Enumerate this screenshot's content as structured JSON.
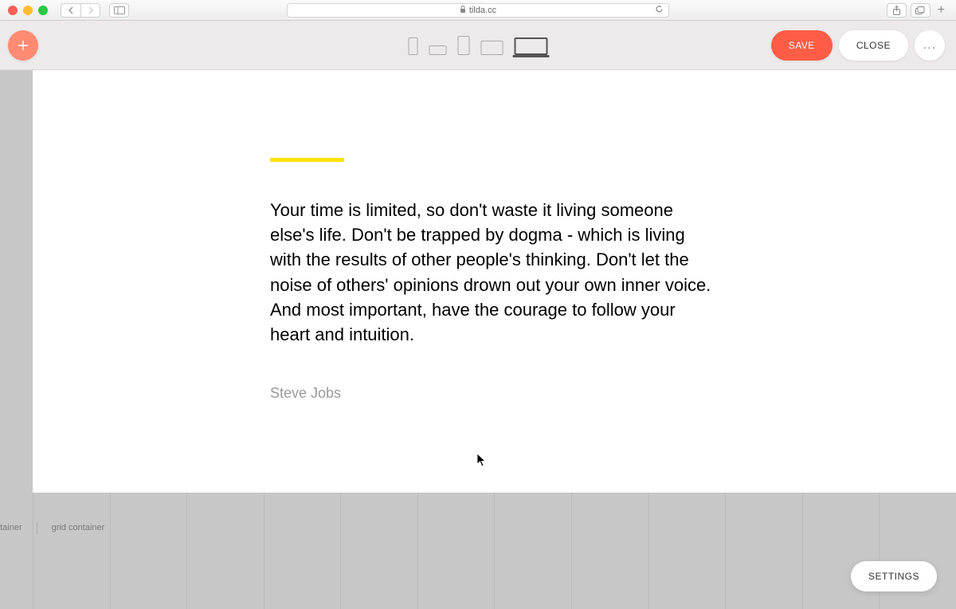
{
  "browser": {
    "url_host": "tilda.cc"
  },
  "toolbar": {
    "save_label": "SAVE",
    "close_label": "CLOSE",
    "more_label": "..."
  },
  "content": {
    "quote": "Your time is limited, so don't waste it living someone else's life. Don't be trapped by dogma - which is living with the results of other people's thinking. Don't let the noise of others' opinions drown out your own inner voice. And most important, have the courage to follow your heart and intuition.",
    "author": "Steve Jobs",
    "accent_color": "#ffe100"
  },
  "footer": {
    "label_left": "ntainer",
    "label_right": "grid container"
  },
  "settings_label": "SETTINGS",
  "colors": {
    "primary": "#fd5d47",
    "add_btn": "#ff8b72"
  }
}
